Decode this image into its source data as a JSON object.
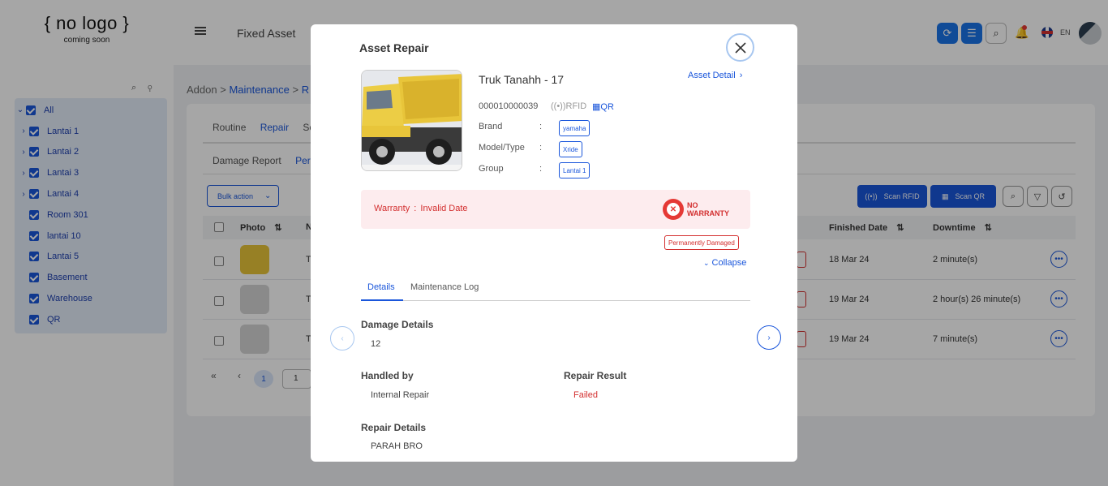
{
  "app": {
    "logo_main": "{ no logo }",
    "logo_sub": "coming soon",
    "page_title": "Fixed Asset",
    "lang": "EN"
  },
  "sidebar": {
    "items": [
      {
        "label": "All",
        "expandable": true
      },
      {
        "label": "Lantai 1",
        "expandable": true
      },
      {
        "label": "Lantai 2",
        "expandable": true
      },
      {
        "label": "Lantai 3",
        "expandable": true
      },
      {
        "label": "Lantai 4",
        "expandable": true
      },
      {
        "label": "Room 301",
        "expandable": false
      },
      {
        "label": "lantai 10",
        "expandable": false
      },
      {
        "label": "Lantai 5",
        "expandable": false
      },
      {
        "label": "Basement",
        "expandable": false
      },
      {
        "label": "Warehouse",
        "expandable": false
      },
      {
        "label": "QR",
        "expandable": false
      }
    ]
  },
  "breadcrumb": {
    "root": "Addon",
    "sep": ">",
    "link": "Maintenance",
    "sep2": ">",
    "cut": "R"
  },
  "tabs1": [
    "Routine",
    "Repair",
    "Se"
  ],
  "tabs2": [
    "Damage Report",
    "Perm"
  ],
  "toolbar": {
    "bulk_action": "Bulk action",
    "scan_rfid": "Scan RFID",
    "scan_qr": "Scan QR"
  },
  "table": {
    "headers": {
      "photo": "Photo",
      "name": "N",
      "finished": "Finished Date",
      "downtime": "Downtime"
    },
    "rows": [
      {
        "name_cut": "T",
        "finished": "18 Mar 24",
        "downtime": "2 minute(s)"
      },
      {
        "name_cut": "T",
        "finished": "19 Mar 24",
        "downtime": "2 hour(s) 26 minute(s)"
      },
      {
        "name_cut": "T",
        "finished": "19 Mar 24",
        "downtime": "7 minute(s)"
      }
    ]
  },
  "pager": {
    "first": "«",
    "prev": "‹",
    "current": "1",
    "input": "1"
  },
  "modal": {
    "title": "Asset Repair",
    "asset_name": "Truk Tanahh - 17",
    "asset_detail_link": "Asset Detail",
    "asset_code": "000010000039",
    "rfid": "RFID",
    "qr": "QR",
    "props": [
      {
        "label": "Brand",
        "colon": ":",
        "value": "yamaha"
      },
      {
        "label": "Model/Type",
        "colon": ":",
        "value": "Xride"
      },
      {
        "label": "Group",
        "colon": ":",
        "value": "Lantai 1"
      }
    ],
    "warranty_label": "Warranty",
    "warranty_sep": ":",
    "warranty_value": "Invalid Date",
    "no_warranty_line1": "NO",
    "no_warranty_line2": "WARRANTY",
    "status_badge": "Permanently Damaged",
    "collapse": "Collapse",
    "tabs": [
      "Details",
      "Maintenance Log"
    ],
    "damage_details_label": "Damage Details",
    "damage_details_value": "12",
    "handled_by_label": "Handled by",
    "handled_by_value": "Internal Repair",
    "repair_result_label": "Repair Result",
    "repair_result_value": "Failed",
    "repair_details_label": "Repair Details",
    "repair_details_value": "PARAH BRO"
  },
  "colors": {
    "primary": "#1a56db",
    "danger": "#d32f2f",
    "warranty_bg": "#fdecee",
    "truck": "#e8c53a"
  }
}
